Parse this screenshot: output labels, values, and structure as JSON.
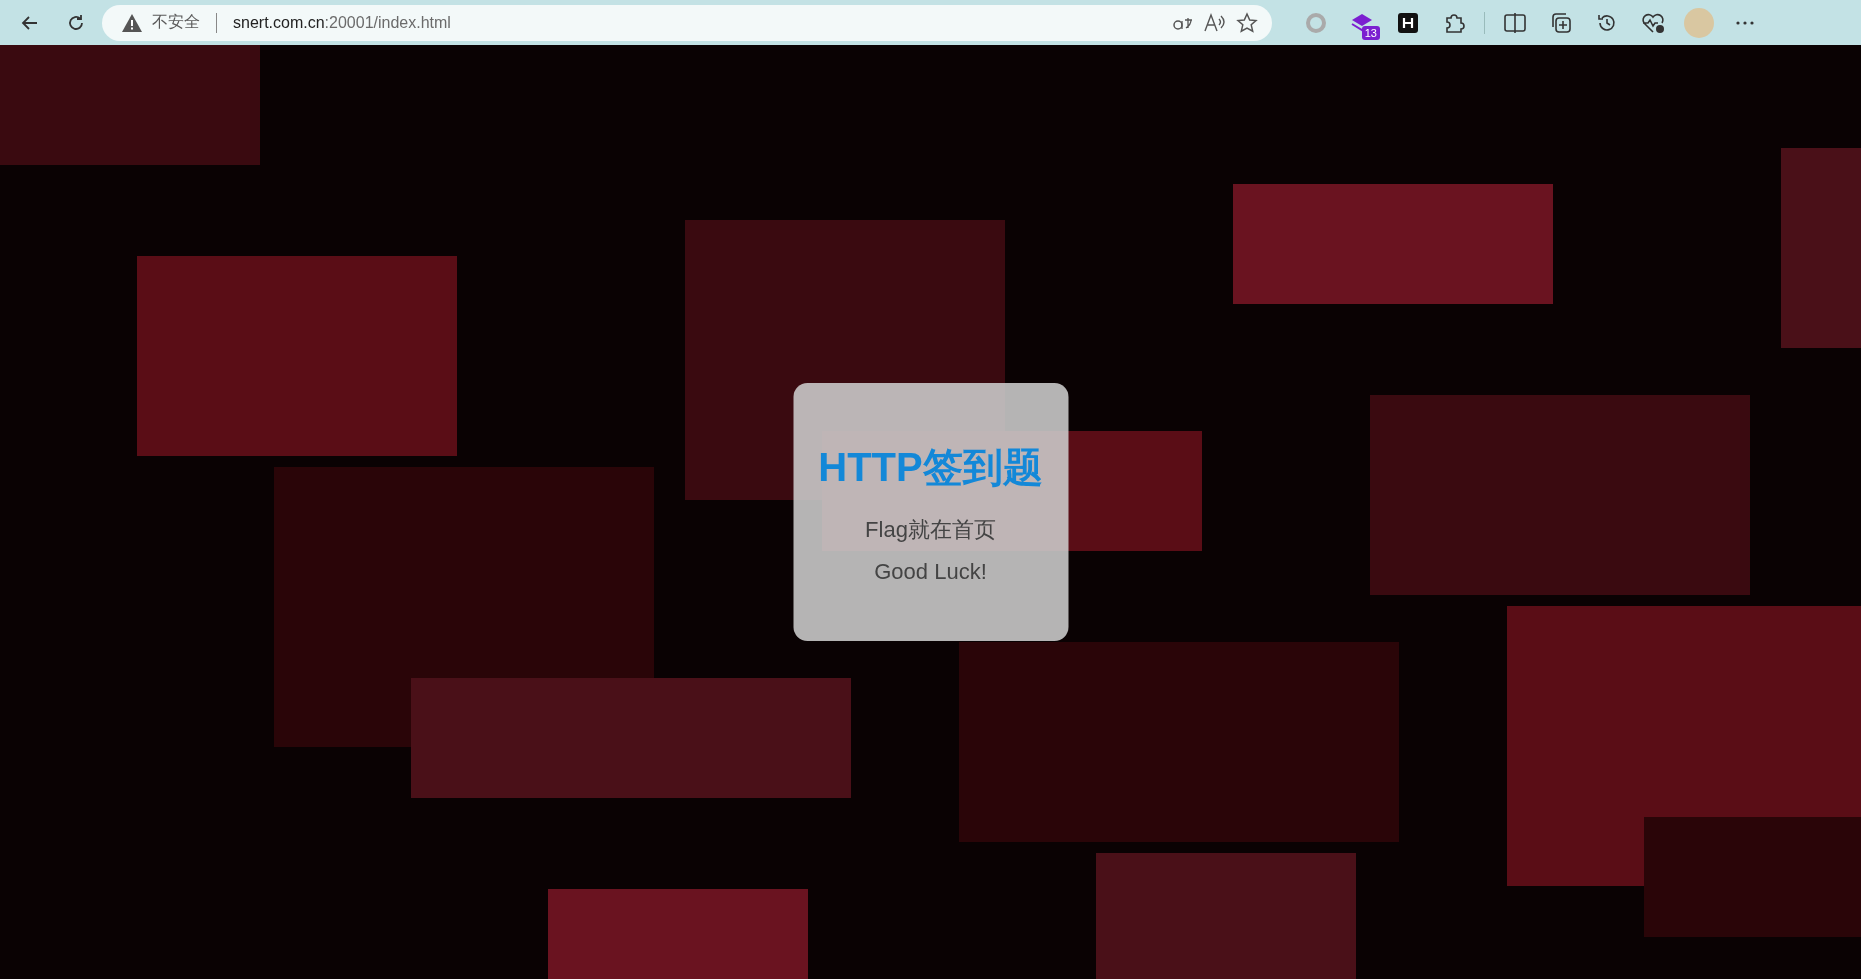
{
  "browser": {
    "security_label": "不安全",
    "url_host": "snert.com.cn",
    "url_rest": ":20001/index.html",
    "extension_badge": "13"
  },
  "page": {
    "card": {
      "title": "HTTP签到题",
      "line_1": "Flag就在首页",
      "line_2": "Good Luck!"
    }
  }
}
